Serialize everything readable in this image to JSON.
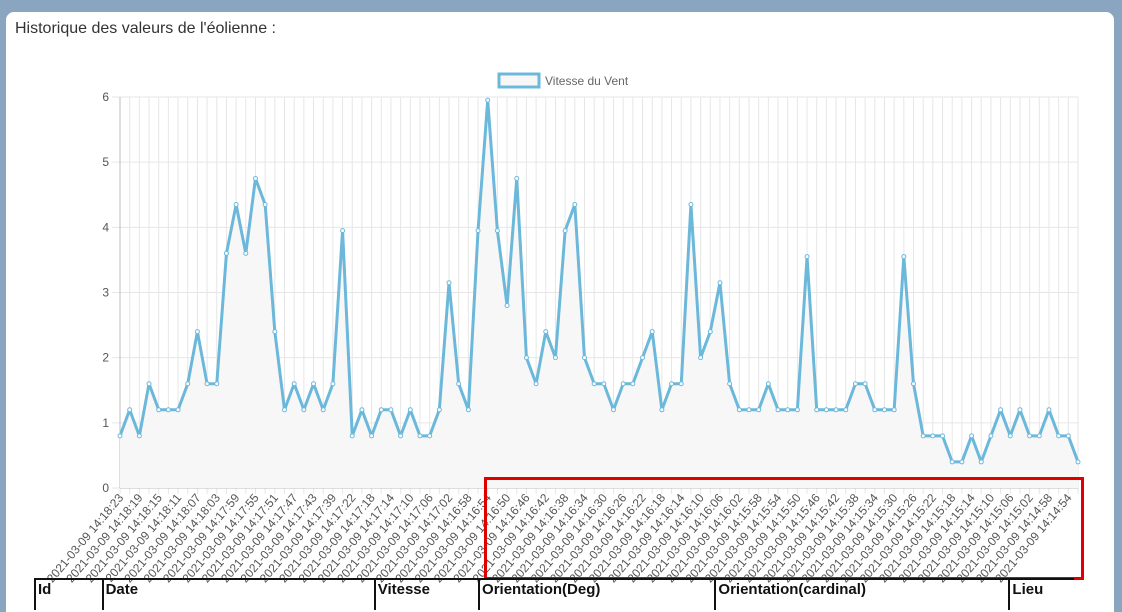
{
  "page": {
    "title": "Historique des valeurs de l'éolienne :"
  },
  "colors": {
    "line": "#6cb8db",
    "fill": "#f7f7f7",
    "grid": "#e6e6e6",
    "highlight": "#e00000"
  },
  "chart_data": {
    "type": "line",
    "title": "",
    "xlabel": "",
    "ylabel": "",
    "ylim": [
      0,
      6
    ],
    "yticks": [
      0,
      1,
      2,
      3,
      4,
      5,
      6
    ],
    "grid": true,
    "legend_position": "top",
    "series": [
      {
        "name": "Vitesse du Vent",
        "values": [
          0.8,
          1.2,
          0.8,
          1.6,
          1.2,
          1.2,
          1.2,
          1.6,
          2.4,
          1.6,
          1.6,
          3.6,
          4.35,
          3.6,
          4.75,
          4.35,
          2.4,
          1.2,
          1.6,
          1.2,
          1.6,
          1.2,
          1.6,
          3.95,
          0.8,
          1.2,
          0.8,
          1.2,
          1.2,
          0.8,
          1.2,
          0.8,
          0.8,
          1.2,
          3.15,
          1.6,
          1.2,
          3.95,
          5.95,
          3.95,
          2.8,
          4.75,
          2.0,
          1.6,
          2.4,
          2.0,
          3.95,
          4.35,
          2.0,
          1.6,
          1.6,
          1.2,
          1.6,
          1.6,
          2.0,
          2.4,
          1.2,
          1.6,
          1.6,
          4.35,
          2.0,
          2.4,
          3.15,
          1.6,
          1.2,
          1.2,
          1.2,
          1.6,
          1.2,
          1.2,
          1.2,
          3.55,
          1.2,
          1.2,
          1.2,
          1.2,
          1.6,
          1.6,
          1.2,
          1.2,
          1.2,
          3.55,
          1.6,
          0.8,
          0.8,
          0.8,
          0.4,
          0.4,
          0.8,
          0.4,
          0.8,
          1.2,
          0.8,
          1.2,
          0.8,
          0.8,
          1.2,
          0.8,
          0.8,
          0.4
        ]
      }
    ],
    "x_tick_labels": [
      "2021-03-09 14:18:23",
      "2021-03-09 14:18:19",
      "2021-03-09 14:18:15",
      "2021-03-09 14:18:11",
      "2021-03-09 14:18:07",
      "2021-03-09 14:18:03",
      "2021-03-09 14:17:59",
      "2021-03-09 14:17:55",
      "2021-03-09 14:17:51",
      "2021-03-09 14:17:47",
      "2021-03-09 14:17:43",
      "2021-03-09 14:17:39",
      "2021-03-09 14:17:22",
      "2021-03-09 14:17:18",
      "2021-03-09 14:17:14",
      "2021-03-09 14:17:10",
      "2021-03-09 14:17:06",
      "2021-03-09 14:17:02",
      "2021-03-09 14:16:58",
      "2021-03-09 14:16:54",
      "2021-03-09 14:16:50",
      "2021-03-09 14:16:46",
      "2021-03-09 14:16:42",
      "2021-03-09 14:16:38",
      "2021-03-09 14:16:34",
      "2021-03-09 14:16:30",
      "2021-03-09 14:16:26",
      "2021-03-09 14:16:22",
      "2021-03-09 14:16:18",
      "2021-03-09 14:16:14",
      "2021-03-09 14:16:10",
      "2021-03-09 14:16:06",
      "2021-03-09 14:16:02",
      "2021-03-09 14:15:58",
      "2021-03-09 14:15:54",
      "2021-03-09 14:15:50",
      "2021-03-09 14:15:46",
      "2021-03-09 14:15:42",
      "2021-03-09 14:15:38",
      "2021-03-09 14:15:34",
      "2021-03-09 14:15:30",
      "2021-03-09 14:15:26",
      "2021-03-09 14:15:22",
      "2021-03-09 14:15:18",
      "2021-03-09 14:15:14",
      "2021-03-09 14:15:10",
      "2021-03-09 14:15:06",
      "2021-03-09 14:15:02",
      "2021-03-09 14:14:58",
      "2021-03-09 14:14:54"
    ]
  },
  "table": {
    "headers": [
      "Id",
      "Date",
      "Vitesse",
      "Orientation(Deg)",
      "Orientation(cardinal)",
      "Lieu"
    ]
  }
}
